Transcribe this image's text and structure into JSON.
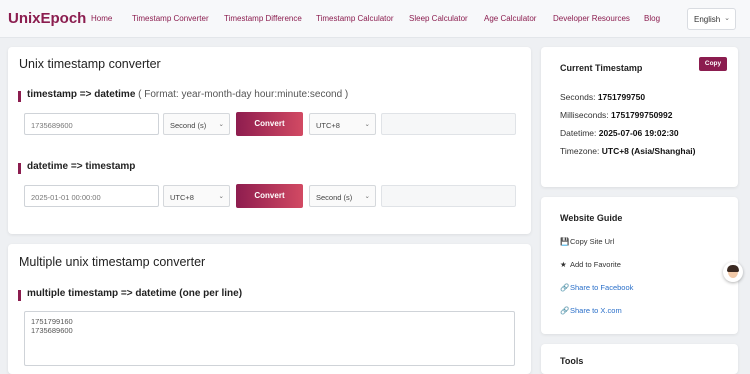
{
  "nav": {
    "brand": "UnixEpoch",
    "items": [
      "Home",
      "Timestamp Converter",
      "Timestamp Difference",
      "Timestamp Calculator",
      "Sleep Calculator",
      "Age Calculator",
      "Developer Resources",
      "Blog"
    ],
    "language": "English"
  },
  "converter": {
    "title": "Unix timestamp converter",
    "ts_to_dt": {
      "label": "timestamp => datetime",
      "format_hint": "( Format: year-month-day hour:minute:second )",
      "input_placeholder": "1735689600",
      "unit": "Second (s)",
      "button": "Convert",
      "timezone": "UTC+8",
      "output": ""
    },
    "dt_to_ts": {
      "label": "datetime => timestamp",
      "input_placeholder": "2025-01-01 00:00:00",
      "timezone": "UTC+8",
      "button": "Convert",
      "unit": "Second (s)",
      "output": ""
    }
  },
  "multi": {
    "title": "Multiple unix timestamp converter",
    "label": "multiple timestamp => datetime (one per line)",
    "lines": [
      "1751799160",
      "1735689600"
    ]
  },
  "current": {
    "title": "Current Timestamp",
    "copy_label": "Copy",
    "seconds_label": "Seconds:",
    "seconds": "1751799750",
    "ms_label": "Milliseconds:",
    "ms": "1751799750992",
    "datetime_label": "Datetime:",
    "datetime": "2025-07-06 19:02:30",
    "tz_label": "Timezone:",
    "tz": "UTC+8 (Asia/Shanghai)"
  },
  "guide": {
    "title": "Website Guide",
    "copy_url": "Copy Site Url",
    "favorite": "Add to Favorite",
    "facebook": "Share to Facebook",
    "x": "Share to X.com"
  },
  "tools": {
    "title": "Tools"
  },
  "icons": {
    "copy_url": "floppy-icon",
    "favorite": "star-icon",
    "facebook": "link-icon",
    "x": "link-icon",
    "dropdown": "chevron-down-icon"
  },
  "colors": {
    "brand": "#8b1d4f",
    "link": "#2a6fc9",
    "button_gradient_end": "#d24a63"
  }
}
